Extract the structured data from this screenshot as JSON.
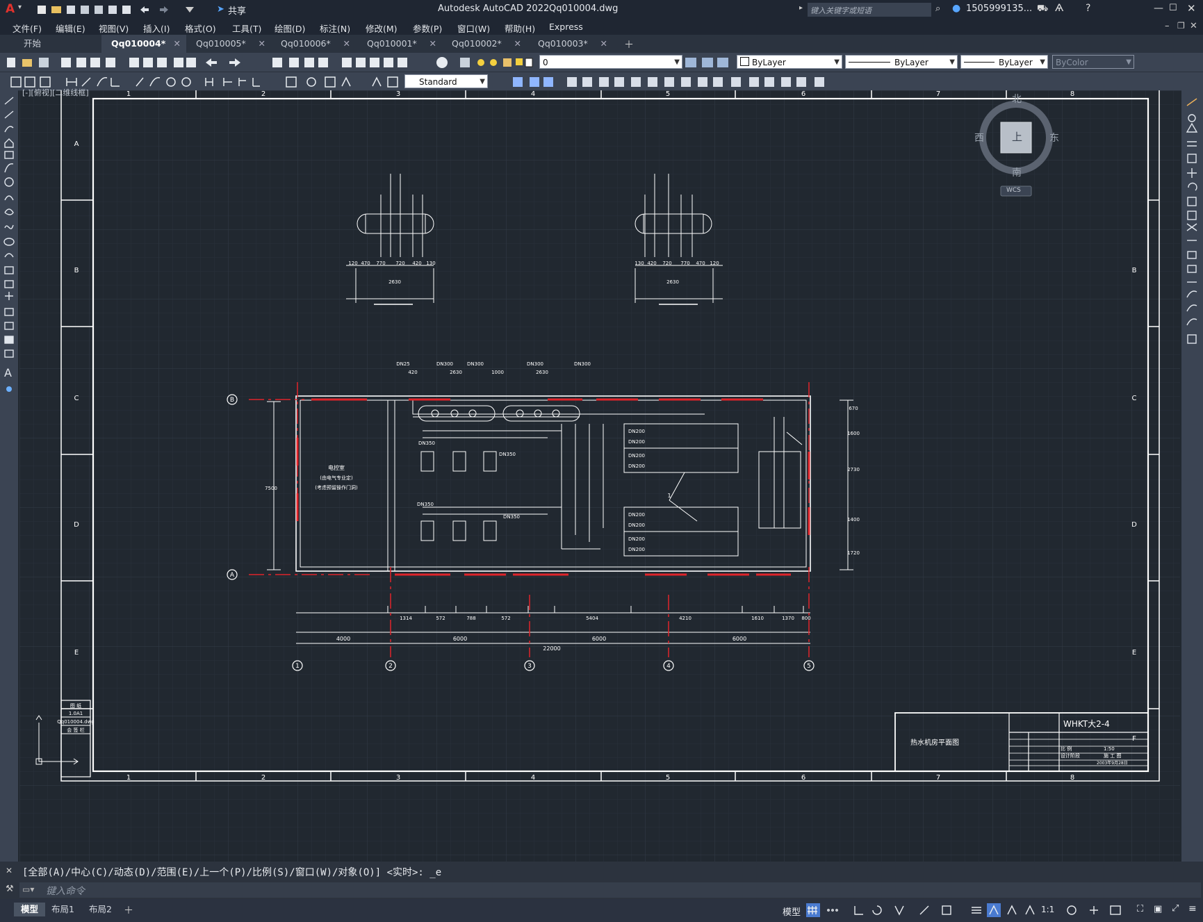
{
  "app": {
    "title": "Autodesk AutoCAD 2022",
    "filename": "Qq010004.dwg",
    "search_placeholder": "键入关键字或短语",
    "user": "1505999135...",
    "share": "共享"
  },
  "menu": [
    "文件(F)",
    "编辑(E)",
    "视图(V)",
    "插入(I)",
    "格式(O)",
    "工具(T)",
    "绘图(D)",
    "标注(N)",
    "修改(M)",
    "参数(P)",
    "窗口(W)",
    "帮助(H)",
    "Express"
  ],
  "tabs": [
    {
      "label": "开始",
      "active": false,
      "closable": false
    },
    {
      "label": "Qq010004*",
      "active": true,
      "closable": true
    },
    {
      "label": "Qq010005*",
      "active": false,
      "closable": true
    },
    {
      "label": "Qq010006*",
      "active": false,
      "closable": true
    },
    {
      "label": "Qq010001*",
      "active": false,
      "closable": true
    },
    {
      "label": "Qq010002*",
      "active": false,
      "closable": true
    },
    {
      "label": "Qq010003*",
      "active": false,
      "closable": true
    }
  ],
  "properties": {
    "layer": "0",
    "color": "ByLayer",
    "linetype": "ByLayer",
    "lineweight": "ByLayer",
    "plotstyle": "ByColor",
    "textstyle": "Standard"
  },
  "viewport_label": "[-][俯视][二维线框]",
  "viewcube": {
    "north": "北",
    "south": "南",
    "east": "东",
    "west": "西",
    "face": "上",
    "wcs": "WCS"
  },
  "drawing": {
    "col_labels": [
      "1",
      "2",
      "3",
      "4",
      "5",
      "6",
      "7",
      "8"
    ],
    "row_labels": [
      "A",
      "B",
      "C",
      "D",
      "E",
      "F"
    ],
    "axis_numbers": [
      "1",
      "2",
      "3",
      "4",
      "5"
    ],
    "axis_letters": [
      "B",
      "A"
    ],
    "overall_dim": "22000",
    "bay_dims": [
      "4000",
      "6000",
      "6000",
      "6000"
    ],
    "bottom_dims": [
      "1314",
      "572",
      "788",
      "572",
      "788",
      "572",
      "5404",
      "4210",
      "1610",
      "1370",
      "800"
    ],
    "left_dim": "7500",
    "right_dims": [
      "670",
      "1600",
      "2730",
      "1400",
      "1720"
    ],
    "top_dims": [
      "420",
      "2630",
      "1000",
      "2630"
    ],
    "room_text": [
      "电控室",
      "(由电气专业定)",
      "(考虑预留操作门洞)"
    ],
    "dn_labels": [
      "DN200",
      "DN200",
      "DN200",
      "DN200",
      "DN200",
      "DN200",
      "DN200",
      "DN200"
    ],
    "pipe_labels": [
      "DN350",
      "DN350",
      "DN350",
      "DN350",
      "DN25",
      "DN300",
      "DN300",
      "DN300",
      "DN300"
    ],
    "tank_dims_left": [
      "120",
      "470",
      "770",
      "720",
      "420",
      "130"
    ],
    "tank_dims_right": [
      "130",
      "420",
      "720",
      "770",
      "470",
      "120"
    ],
    "tank_total": "2630",
    "section_mark": "1",
    "title_block": {
      "drawing_title": "热水机房平面图",
      "code": "WHKT大2-4",
      "scale_label": "比 例",
      "scale": "1:50",
      "stage_label": "设计阶段",
      "stage": "施 工 图",
      "date": "2003年9月28日"
    },
    "side_table": [
      "图 纸",
      "1.0A1",
      "Qq010004.dwg",
      "会 签 栏"
    ]
  },
  "command": {
    "history": "[全部(A)/中心(C)/动态(D)/范围(E)/上一个(P)/比例(S)/窗口(W)/对象(O)] <实时>: _e",
    "placeholder": "键入命令"
  },
  "layout_tabs": [
    "模型",
    "布局1",
    "布局2"
  ],
  "status": {
    "model": "模型",
    "scale": "1:1"
  }
}
